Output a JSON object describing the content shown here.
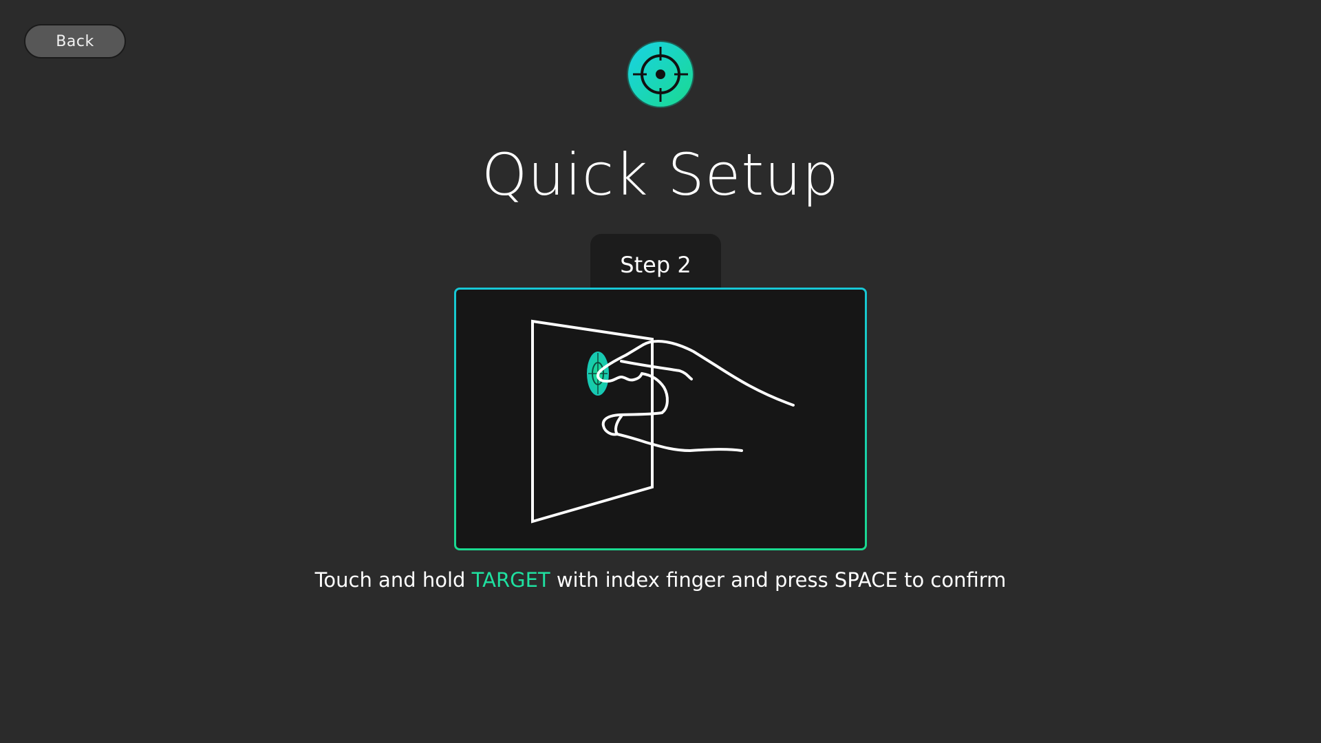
{
  "back_button": {
    "label": "Back"
  },
  "logo": {
    "icon": "crosshair-target-icon"
  },
  "title": "Quick Setup",
  "step": {
    "label": "Step 2"
  },
  "illustration": {
    "icon": "hand-touching-target-icon"
  },
  "instruction": {
    "before": "Touch and hold ",
    "highlight": "TARGET",
    "after": " with index finger and press SPACE to confirm"
  },
  "colors": {
    "background": "#2b2b2b",
    "accent_cyan": "#17c7d6",
    "accent_green": "#1ad98f",
    "highlight_text": "#1fe0a0",
    "panel": "#161616"
  }
}
